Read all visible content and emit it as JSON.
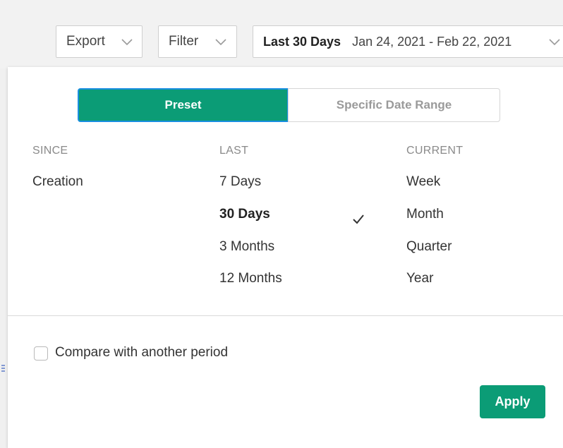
{
  "toolbar": {
    "export_label": "Export",
    "filter_label": "Filter",
    "date_range_preset": "Last 30 Days",
    "date_range_text": "Jan 24, 2021 - Feb 22, 2021"
  },
  "picker": {
    "tabs": {
      "preset": "Preset",
      "specific": "Specific Date Range"
    },
    "columns": {
      "since": {
        "header": "SINCE",
        "options": [
          "Creation"
        ]
      },
      "last": {
        "header": "LAST",
        "options": [
          "7 Days",
          "30 Days",
          "3 Months",
          "12 Months"
        ],
        "selected": "30 Days"
      },
      "current": {
        "header": "CURRENT",
        "options": [
          "Week",
          "Month",
          "Quarter",
          "Year"
        ]
      }
    },
    "compare_label": "Compare with another period",
    "compare_checked": false,
    "apply_label": "Apply"
  },
  "colors": {
    "accent": "#0b9c76",
    "focus_border": "#1a8fe0",
    "header_text": "#8a8a8a"
  },
  "icons": {
    "dropdown": "chevron-down-icon",
    "selected": "checkmark-icon"
  }
}
